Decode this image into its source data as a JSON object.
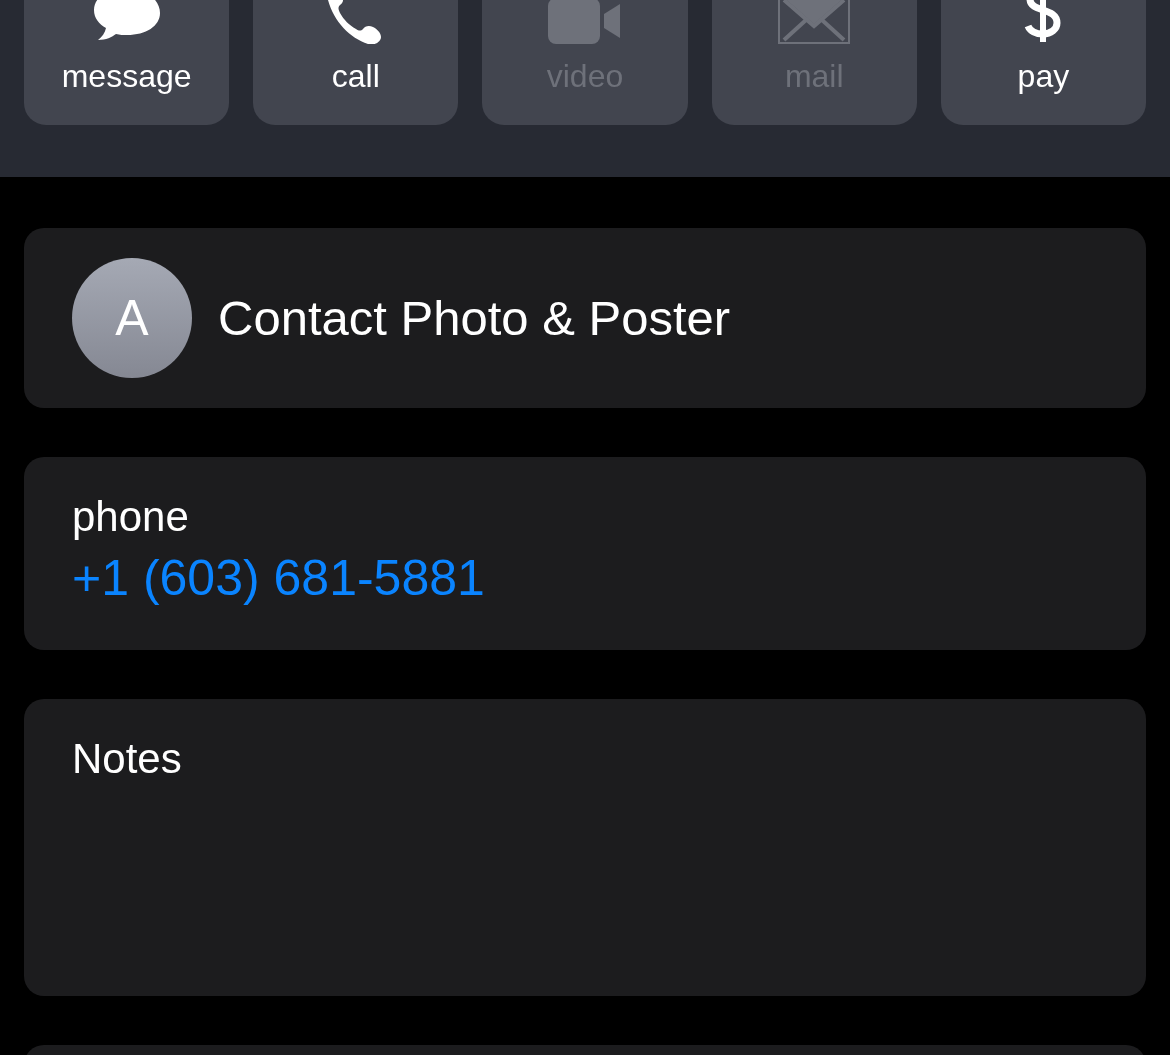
{
  "actions": [
    {
      "kind": "message",
      "label": "message",
      "disabled": false
    },
    {
      "kind": "call",
      "label": "call",
      "disabled": false
    },
    {
      "kind": "video",
      "label": "video",
      "disabled": true
    },
    {
      "kind": "mail",
      "label": "mail",
      "disabled": true
    },
    {
      "kind": "pay",
      "label": "pay",
      "disabled": false
    }
  ],
  "photo_card": {
    "initial": "A",
    "label": "Contact Photo & Poster"
  },
  "phone": {
    "label": "phone",
    "number": "+1 (603) 681-5881"
  },
  "notes": {
    "label": "Notes"
  }
}
